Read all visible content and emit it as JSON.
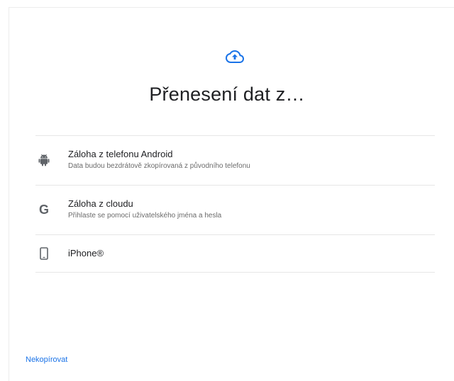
{
  "header": {
    "icon": "cloud-upload-icon",
    "title": "Přenesení dat z…"
  },
  "options": [
    {
      "icon": "android-icon",
      "title": "Záloha z telefonu Android",
      "subtitle": "Data budou bezdrátově zkopírovaná z původního telefonu"
    },
    {
      "icon": "google-g-icon",
      "title": "Záloha z cloudu",
      "subtitle": "Přihlaste se pomocí uživatelského jména a hesla"
    },
    {
      "icon": "phone-icon",
      "title": "iPhone®",
      "subtitle": ""
    }
  ],
  "footer": {
    "skip_label": "Nekopírovat"
  },
  "colors": {
    "accent": "#1a73e8",
    "icon_gray": "#5f6368"
  }
}
